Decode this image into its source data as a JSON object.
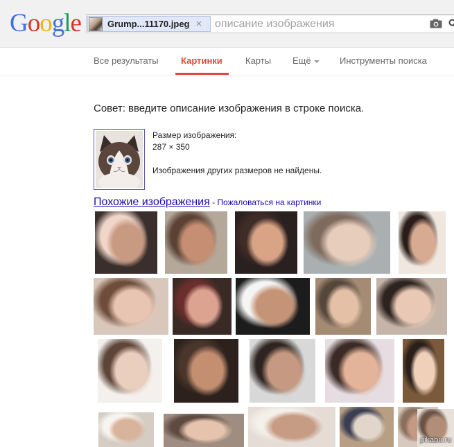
{
  "header": {
    "logo": "Google",
    "logo_colors": [
      "#3f6fe0",
      "#d8352a",
      "#f1b50e",
      "#3f6fe0",
      "#109d58",
      "#d8352a"
    ],
    "chip_filename": "Grump...11170.jpeg",
    "chip_close": "×",
    "search_placeholder": "описание изображения"
  },
  "nav": {
    "items": [
      {
        "label": "Все результаты"
      },
      {
        "label": "Картинки"
      },
      {
        "label": "Карты"
      },
      {
        "label": "Ещё"
      },
      {
        "label": "Инструменты поиска"
      }
    ],
    "active_color": "#dd4b39"
  },
  "content": {
    "tip": "Совет: введите описание изображения в строке поиска.",
    "size_label": "Размер изображения:",
    "size_value": "287 × 350",
    "no_other_sizes": "Изображения других размеров не найдены.",
    "similar_link": "Похожие изображения",
    "separator": " - ",
    "report_link": "Пожаловаться на картинки"
  },
  "watermark": "pikabu.ru",
  "tiles": [
    {
      "row": 0,
      "colors": [
        "#3a2f2c",
        "#c99a82",
        "#f0d6c9"
      ]
    },
    {
      "row": 0,
      "colors": [
        "#b3a89a",
        "#c68f74",
        "#5b4234"
      ]
    },
    {
      "row": 0,
      "colors": [
        "#2b2020",
        "#d9a486",
        "#3e2c27"
      ]
    },
    {
      "row": 0,
      "colors": [
        "#aab0b1",
        "#e7cdbb",
        "#7f6b5e"
      ]
    },
    {
      "row": 0,
      "colors": [
        "#efe7e0",
        "#d7ab92",
        "#2a1d18"
      ]
    },
    {
      "row": 1,
      "colors": [
        "#d9c7bb",
        "#e8c4b2",
        "#6e4d3a"
      ]
    },
    {
      "row": 1,
      "colors": [
        "#3a2a26",
        "#dca391",
        "#6a2e2c"
      ]
    },
    {
      "row": 1,
      "colors": [
        "#1c1c1c",
        "#c59476",
        "#f5f5f5"
      ]
    },
    {
      "row": 1,
      "colors": [
        "#a58b74",
        "#e4c1a6",
        "#55473c"
      ]
    },
    {
      "row": 1,
      "colors": [
        "#c5b4a8",
        "#e9c9b5",
        "#2d231f"
      ]
    },
    {
      "row": 2,
      "colors": [
        "#f3f0ee",
        "#eacfbf",
        "#5d4638"
      ]
    },
    {
      "row": 2,
      "colors": [
        "#2c211c",
        "#c48e70",
        "#4a362b"
      ]
    },
    {
      "row": 2,
      "colors": [
        "#d8d8d8",
        "#c69a82",
        "#2e2522"
      ]
    },
    {
      "row": 2,
      "colors": [
        "#e6dde2",
        "#e3b39a",
        "#3b2a25"
      ]
    },
    {
      "row": 2,
      "colors": [
        "#7a5a3a",
        "#f0d0b8",
        "#2a1f1a"
      ]
    },
    {
      "row": 3,
      "colors": [
        "#d5cdc4",
        "#d9b49c",
        "#f7f4ef"
      ]
    },
    {
      "row": 3,
      "colors": [
        "#9e8d80",
        "#e5c3ad",
        "#5e4a40"
      ]
    },
    {
      "row": 3,
      "colors": [
        "#e5ddd5",
        "#c79c84",
        "#f3efe9"
      ]
    },
    {
      "row": 3,
      "colors": [
        "#b89e83",
        "#e2d6cb",
        "#3b3f54"
      ]
    },
    {
      "row": 3,
      "colors": [
        "#d7c9bd",
        "#c49a84",
        "#8a6f5c"
      ]
    },
    {
      "row": 3,
      "colors": [
        "#e8e1d9",
        "#b28d78",
        "#6b5447"
      ]
    }
  ]
}
